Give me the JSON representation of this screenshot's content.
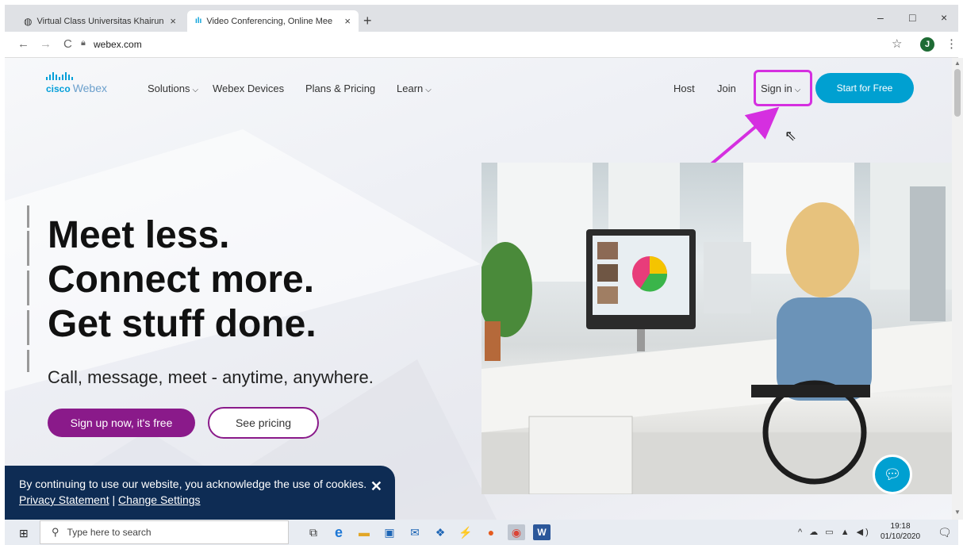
{
  "browser": {
    "tabs": [
      {
        "title": "Virtual Class Universitas Khairun",
        "close": "×"
      },
      {
        "title": "Video Conferencing, Online Mee",
        "close": "×"
      }
    ],
    "new_tab": "+",
    "window_controls": {
      "minimize": "–",
      "maximize": "□",
      "close": "×"
    },
    "nav": {
      "back": "←",
      "forward": "→",
      "reload": "C"
    },
    "url": "webex.com",
    "profile_initial": "J"
  },
  "site": {
    "logo": {
      "brand": "cisco",
      "product": "Webex"
    },
    "nav": [
      {
        "label": "Solutions",
        "has_dropdown": true
      },
      {
        "label": "Webex Devices"
      },
      {
        "label": "Plans & Pricing"
      },
      {
        "label": "Learn",
        "has_dropdown": true
      }
    ],
    "right_nav": {
      "host": "Host",
      "join": "Join",
      "sign_in": "Sign in",
      "start": "Start for Free"
    },
    "hero": {
      "lines": [
        "Meet less.",
        "Connect more.",
        "Get stuff done."
      ],
      "subtitle": "Call, message, meet - anytime, anywhere.",
      "primary_cta": "Sign up now, it's free",
      "secondary_cta": "See pricing"
    },
    "cookie": {
      "text": "By continuing to use our website, you acknowledge the use of cookies.",
      "privacy_link": "Privacy Statement",
      "separator": "|",
      "settings_link": "Change Settings",
      "close": "✕"
    },
    "accent_colors": {
      "brand_blue": "#00a0d1",
      "purple": "#8a1a8a",
      "annotation": "#d52fe0",
      "cookie_bg": "#0e2c54"
    }
  },
  "taskbar": {
    "search_placeholder": "Type here to search",
    "time": "19:18",
    "date": "01/10/2020"
  }
}
